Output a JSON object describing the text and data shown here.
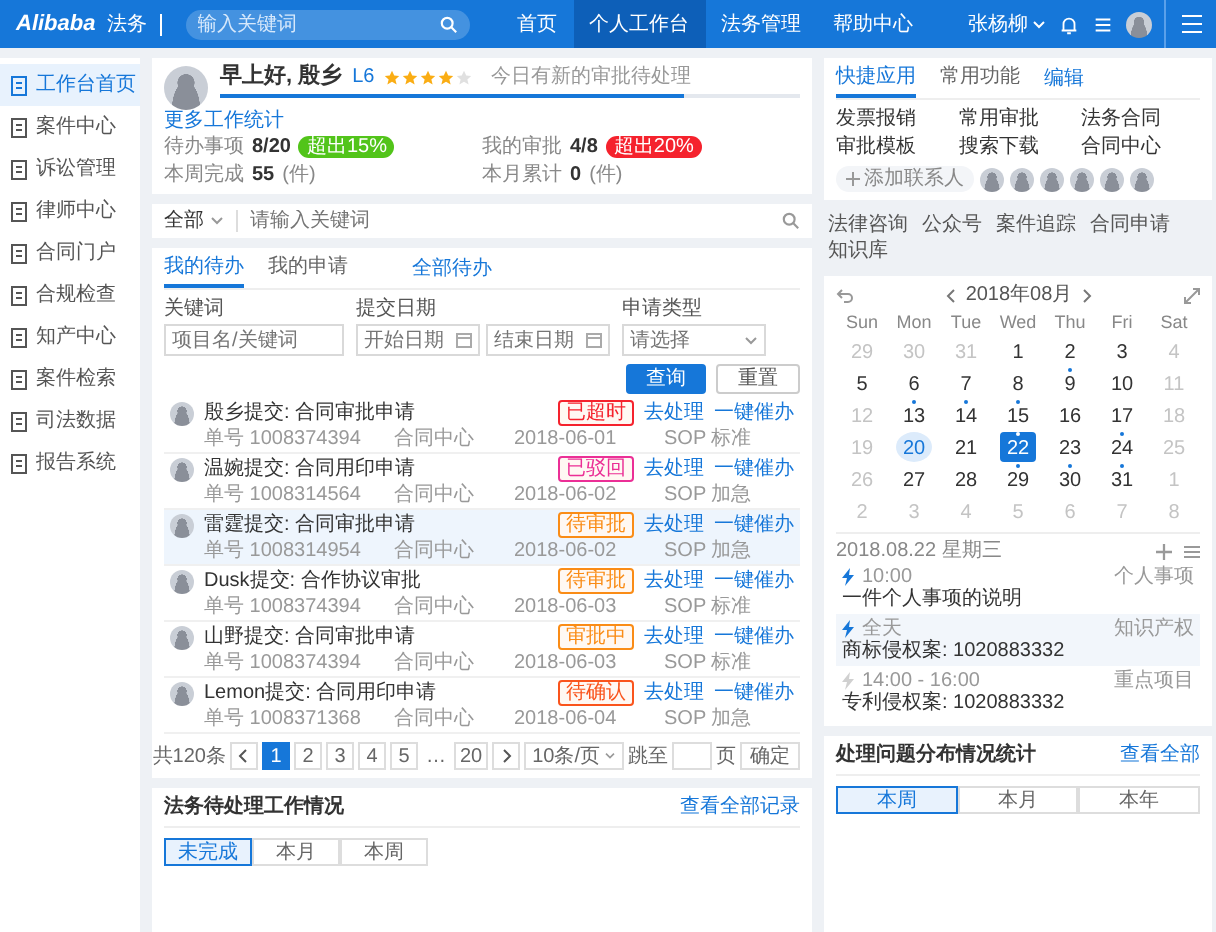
{
  "header": {
    "logo": "Alibaba",
    "logo_sub": "法务",
    "search": {
      "placeholder": "输入关键词"
    },
    "nav": [
      {
        "label": "首页",
        "selected": false
      },
      {
        "label": "个人工作台",
        "selected": true
      },
      {
        "label": "法务管理",
        "selected": false
      },
      {
        "label": "帮助中心",
        "selected": false
      }
    ],
    "user": "张杨柳"
  },
  "sidebar": {
    "items": [
      {
        "label": "工作台首页",
        "selected": true
      },
      {
        "label": "案件中心",
        "selected": false
      },
      {
        "label": "诉讼管理",
        "selected": false
      },
      {
        "label": "律师中心",
        "selected": false
      },
      {
        "label": "合同门户",
        "selected": false
      },
      {
        "label": "合规检查",
        "selected": false
      },
      {
        "label": "知产中心",
        "selected": false
      },
      {
        "label": "案件检索",
        "selected": false
      },
      {
        "label": "司法数据",
        "selected": false
      },
      {
        "label": "报告系统",
        "selected": false
      }
    ]
  },
  "profile": {
    "name": "早上好, 殷乡",
    "level_badge": "L6",
    "stars": 4,
    "note": "今日有新的审批待处理",
    "progress": {
      "level": 0.8
    },
    "link": "更多工作统计",
    "stats": [
      {
        "label": "待办事项",
        "value": "8/20",
        "badge": "超出15%",
        "color": "#52c41a"
      },
      {
        "label": "我的审批",
        "value": "4/8",
        "badge": "超出20%",
        "color": "#f5222d"
      },
      {
        "label": "本周完成",
        "value": "55",
        "unit": "(件)"
      },
      {
        "label": "本月累计",
        "value": "0",
        "unit": "(件)"
      }
    ]
  },
  "quick": {
    "tabs": [
      {
        "label": "快捷应用",
        "selected": true
      },
      {
        "label": "常用功能",
        "selected": false
      }
    ],
    "edit": "编辑",
    "links": [
      "发票报销",
      "常用审批",
      "法务合同",
      "审批模板",
      "搜索下载",
      "合同中心"
    ],
    "add_contact": "添加联系人"
  },
  "search": {
    "scope": "全部",
    "placeholder": "请输入关键词"
  },
  "shortcuts": [
    "法律咨询",
    "公众号",
    "案件追踪",
    "合同申请",
    "知识库"
  ],
  "todo": {
    "tabs": [
      {
        "label": "我的待办",
        "selected": true
      },
      {
        "label": "我的申请",
        "selected": false
      }
    ],
    "all_link": "全部待办",
    "filters": {
      "keyword": {
        "label": "关键词",
        "placeholder": "项目名/关键词"
      },
      "date": {
        "label": "提交日期",
        "start_placeholder": "开始日期",
        "end_placeholder": "结束日期"
      },
      "type": {
        "label": "申请类型",
        "placeholder": "请选择"
      }
    },
    "buttons": [
      {
        "label": "查询",
        "kind": "primary"
      },
      {
        "label": "重置",
        "kind": "default"
      }
    ],
    "rows": [
      {
        "title": "殷乡提交: 合同审批申请",
        "status": "已超时",
        "color": "#f5222d",
        "selected": false,
        "actions": [
          "去处理",
          "一键催办"
        ],
        "meta": [
          "单号 1008374394",
          "合同中心",
          "2018-06-01",
          "SOP 标准"
        ]
      },
      {
        "title": "温婉提交: 合同用印申请",
        "status": "已驳回",
        "color": "#eb2f96",
        "selected": false,
        "actions": [
          "去处理",
          "一键催办"
        ],
        "meta": [
          "单号 1008314564",
          "合同中心",
          "2018-06-02",
          "SOP 加急"
        ]
      },
      {
        "title": "雷霆提交: 合同审批申请",
        "status": "待审批",
        "color": "#fa8c16",
        "selected": true,
        "actions": [
          "去处理",
          "一键催办"
        ],
        "meta": [
          "单号 1008314954",
          "合同中心",
          "2018-06-02",
          "SOP 加急"
        ]
      },
      {
        "title": "Dusk提交: 合作协议审批",
        "status": "待审批",
        "color": "#fa8c16",
        "selected": false,
        "actions": [
          "去处理",
          "一键催办"
        ],
        "meta": [
          "单号 1008374394",
          "合同中心",
          "2018-06-03",
          "SOP 标准"
        ]
      },
      {
        "title": "山野提交: 合同审批申请",
        "status": "审批中",
        "color": "#fa8c16",
        "selected": false,
        "actions": [
          "去处理",
          "一键催办"
        ],
        "meta": [
          "单号 1008374394",
          "合同中心",
          "2018-06-03",
          "SOP 标准"
        ]
      },
      {
        "title": "Lemon提交: 合同用印申请",
        "status": "待确认",
        "color": "#fa541c",
        "selected": false,
        "actions": [
          "去处理",
          "一键催办"
        ],
        "meta": [
          "单号 1008371368",
          "合同中心",
          "2018-06-04",
          "SOP 加急"
        ]
      }
    ],
    "pager": {
      "total": "共120条",
      "pages": [
        {
          "label": "1",
          "selected": true,
          "kind": "page"
        },
        {
          "label": "2",
          "selected": false,
          "kind": "page"
        },
        {
          "label": "3",
          "selected": false,
          "kind": "page"
        },
        {
          "label": "4",
          "selected": false,
          "kind": "page"
        },
        {
          "label": "5",
          "selected": false,
          "kind": "page"
        },
        {
          "label": "…",
          "selected": false,
          "kind": "ellipsis"
        },
        {
          "label": "20",
          "selected": false,
          "kind": "page"
        }
      ],
      "page_size": "10条/页",
      "jump_label": "跳至",
      "jump_unit": "页",
      "confirm": "确定"
    }
  },
  "work": {
    "title": "法务待处理工作情况",
    "link": "查看全部记录",
    "tabs": [
      {
        "label": "未完成",
        "selected": true
      },
      {
        "label": "本月",
        "selected": false
      },
      {
        "label": "本周",
        "selected": false
      }
    ]
  },
  "calendar": {
    "month": "2018年08月",
    "weekdays": [
      "Sun",
      "Mon",
      "Tue",
      "Wed",
      "Thu",
      "Fri",
      "Sat"
    ],
    "days": [
      {
        "d": "29",
        "muted": true,
        "dot": false,
        "today": false,
        "selected": false
      },
      {
        "d": "30",
        "muted": true,
        "dot": false,
        "today": false,
        "selected": false
      },
      {
        "d": "31",
        "muted": true,
        "dot": false,
        "today": false,
        "selected": false
      },
      {
        "d": "1",
        "muted": false,
        "dot": false,
        "today": false,
        "selected": false
      },
      {
        "d": "2",
        "muted": false,
        "dot": false,
        "today": false,
        "selected": false
      },
      {
        "d": "3",
        "muted": false,
        "dot": false,
        "today": false,
        "selected": false
      },
      {
        "d": "4",
        "muted": true,
        "dot": false,
        "today": false,
        "selected": false
      },
      {
        "d": "5",
        "muted": false,
        "dot": false,
        "today": false,
        "selected": false
      },
      {
        "d": "6",
        "muted": false,
        "dot": false,
        "today": false,
        "selected": false
      },
      {
        "d": "7",
        "muted": false,
        "dot": false,
        "today": false,
        "selected": false
      },
      {
        "d": "8",
        "muted": false,
        "dot": false,
        "today": false,
        "selected": false
      },
      {
        "d": "9",
        "muted": false,
        "dot": true,
        "today": false,
        "selected": false
      },
      {
        "d": "10",
        "muted": false,
        "dot": false,
        "today": false,
        "selected": false
      },
      {
        "d": "11",
        "muted": true,
        "dot": false,
        "today": false,
        "selected": false
      },
      {
        "d": "12",
        "muted": true,
        "dot": false,
        "today": false,
        "selected": false
      },
      {
        "d": "13",
        "muted": false,
        "dot": true,
        "today": false,
        "selected": false
      },
      {
        "d": "14",
        "muted": false,
        "dot": true,
        "today": false,
        "selected": false
      },
      {
        "d": "15",
        "muted": false,
        "dot": true,
        "today": false,
        "selected": false
      },
      {
        "d": "16",
        "muted": false,
        "dot": false,
        "today": false,
        "selected": false
      },
      {
        "d": "17",
        "muted": false,
        "dot": false,
        "today": false,
        "selected": false
      },
      {
        "d": "18",
        "muted": true,
        "dot": false,
        "today": false,
        "selected": false
      },
      {
        "d": "19",
        "muted": true,
        "dot": false,
        "today": false,
        "selected": false
      },
      {
        "d": "20",
        "muted": false,
        "dot": false,
        "today": true,
        "selected": false
      },
      {
        "d": "21",
        "muted": false,
        "dot": false,
        "today": false,
        "selected": false
      },
      {
        "d": "22",
        "muted": false,
        "dot": true,
        "today": false,
        "selected": true
      },
      {
        "d": "23",
        "muted": false,
        "dot": false,
        "today": false,
        "selected": false
      },
      {
        "d": "24",
        "muted": false,
        "dot": true,
        "today": false,
        "selected": false
      },
      {
        "d": "25",
        "muted": true,
        "dot": false,
        "today": false,
        "selected": false
      },
      {
        "d": "26",
        "muted": true,
        "dot": false,
        "today": false,
        "selected": false
      },
      {
        "d": "27",
        "muted": false,
        "dot": false,
        "today": false,
        "selected": false
      },
      {
        "d": "28",
        "muted": false,
        "dot": false,
        "today": false,
        "selected": false
      },
      {
        "d": "29",
        "muted": false,
        "dot": true,
        "today": false,
        "selected": false
      },
      {
        "d": "30",
        "muted": false,
        "dot": true,
        "today": false,
        "selected": false
      },
      {
        "d": "31",
        "muted": false,
        "dot": true,
        "today": false,
        "selected": false
      },
      {
        "d": "1",
        "muted": true,
        "dot": false,
        "today": false,
        "selected": false
      },
      {
        "d": "2",
        "muted": true,
        "dot": false,
        "today": false,
        "selected": false
      },
      {
        "d": "3",
        "muted": true,
        "dot": false,
        "today": false,
        "selected": false
      },
      {
        "d": "4",
        "muted": true,
        "dot": false,
        "today": false,
        "selected": false
      },
      {
        "d": "5",
        "muted": true,
        "dot": false,
        "today": false,
        "selected": false
      },
      {
        "d": "6",
        "muted": true,
        "dot": false,
        "today": false,
        "selected": false
      },
      {
        "d": "7",
        "muted": true,
        "dot": false,
        "today": false,
        "selected": false
      },
      {
        "d": "8",
        "muted": true,
        "dot": false,
        "today": false,
        "selected": false
      }
    ]
  },
  "events": {
    "date": "2018.08.22 星期三",
    "items": [
      {
        "time": "10:00",
        "tag": "个人事项",
        "text": "一件个人事项的说明",
        "kind": "alert",
        "selected": false
      },
      {
        "time": "全天",
        "tag": "知识产权",
        "text": "商标侵权案: 1020883332",
        "kind": "alert",
        "selected": true
      },
      {
        "time": "14:00 - 16:00",
        "tag": "重点项目",
        "text": "专利侵权案: 1020883332",
        "kind": "plain",
        "selected": false
      }
    ]
  },
  "stats_card": {
    "title": "处理问题分布情况统计",
    "link": "查看全部",
    "tabs": [
      {
        "label": "本周",
        "selected": true
      },
      {
        "label": "本月",
        "selected": false
      },
      {
        "label": "本年",
        "selected": false
      }
    ]
  }
}
